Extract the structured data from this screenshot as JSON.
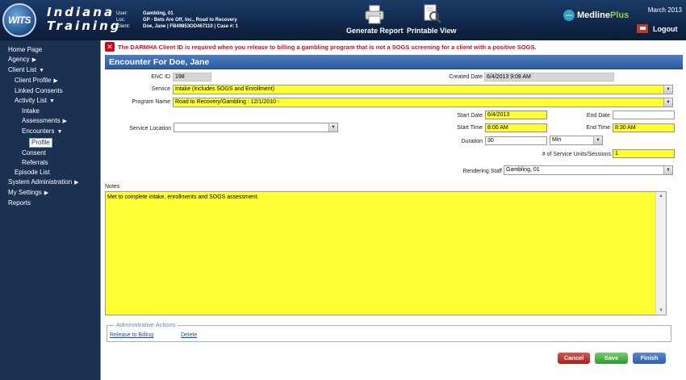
{
  "header": {
    "logo_text": "WITS",
    "title_line1": "Indiana",
    "title_line2": "Training",
    "context": [
      {
        "key": "User:",
        "value": "Gambling, 01"
      },
      {
        "key": "Loc:",
        "value": "GP - Bets Are Off, Inc., Road to Recovery"
      },
      {
        "key": "Client:",
        "value": "Doe, Jane | FB49853OD467110 | Case #: 1"
      }
    ],
    "generate_report": "Generate Report",
    "printable_view": "Printable View",
    "medline_a": "Medline",
    "medline_b": "Plus",
    "date": "March 2013",
    "logout": "Logout"
  },
  "sidebar": {
    "items": [
      {
        "label": "Home Page",
        "indent": 0,
        "arrow": ""
      },
      {
        "label": "Agency",
        "indent": 0,
        "arrow": "▶"
      },
      {
        "label": "Client List",
        "indent": 0,
        "arrow": "▼"
      },
      {
        "label": "Client Profile",
        "indent": 1,
        "arrow": "▶"
      },
      {
        "label": "Linked Consents",
        "indent": 1,
        "arrow": ""
      },
      {
        "label": "Activity List",
        "indent": 1,
        "arrow": "▼"
      },
      {
        "label": "Intake",
        "indent": 2,
        "arrow": ""
      },
      {
        "label": "Assessments",
        "indent": 2,
        "arrow": "▶"
      },
      {
        "label": "Encounters",
        "indent": 2,
        "arrow": "▼"
      },
      {
        "label": "Profile",
        "indent": 3,
        "arrow": "",
        "selected": true
      },
      {
        "label": "Consent",
        "indent": 2,
        "arrow": ""
      },
      {
        "label": "Referrals",
        "indent": 2,
        "arrow": ""
      },
      {
        "label": "Episode List",
        "indent": 1,
        "arrow": ""
      },
      {
        "label": "System Administration",
        "indent": 0,
        "arrow": "▶"
      },
      {
        "label": "My Settings",
        "indent": 0,
        "arrow": "▶"
      },
      {
        "label": "Reports",
        "indent": 0,
        "arrow": ""
      }
    ]
  },
  "main": {
    "error": "The DARMHA Client ID is required when you release to billing a gambling program that is not a SOGS screening for a client with a positive SOGS.",
    "title": "Encounter For Doe, Jane",
    "form": {
      "enc_id_label": "ENC ID",
      "enc_id_value": "198",
      "created_date_label": "Created Date",
      "created_date_value": "6/4/2013 9:08 AM",
      "service_label": "Service",
      "service_value": "Intake (Includes SOGS and Enrollment)",
      "program_label": "Program Name",
      "program_value": "Road to Recovery/Gambling : 12/1/2010 -",
      "start_date_label": "Start Date",
      "start_date_value": "6/4/2013",
      "end_date_label": "End Date",
      "end_date_value": "",
      "service_location_label": "Service Location",
      "service_location_value": "",
      "start_time_label": "Start Time",
      "start_time_value": "8:00 AM",
      "end_time_label": "End Time",
      "end_time_value": "8:30 AM",
      "duration_label": "Duration",
      "duration_value": "30",
      "duration_unit": "Min",
      "units_label": "# of Service Units/Sessions",
      "units_value": "1",
      "rendering_staff_label": "Rendering Staff",
      "rendering_staff_value": "Gambling, 01"
    },
    "notes_label": "Notes",
    "notes_value": "Met to complete intake, enrollments and SOGS assessment.",
    "admin": {
      "legend": "Administrative Actions",
      "release_to_billing": "Release to Billing",
      "delete": "Delete"
    },
    "buttons": {
      "cancel": "Cancel",
      "save": "Save",
      "finish": "Finish"
    }
  },
  "colors": {
    "header_bg": "#0e2344",
    "sidebar_bg": "#1a3152",
    "required_field": "#ffff33",
    "title_bar": "#3a68ad",
    "error_text": "#c8102e"
  }
}
